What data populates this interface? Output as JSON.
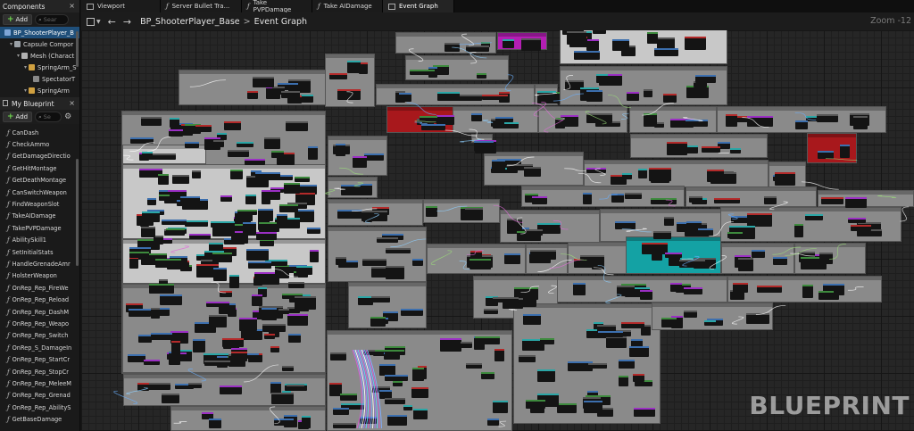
{
  "components_panel": {
    "title": "Components",
    "add_label": "Add",
    "search_placeholder": "Sear",
    "tree": [
      {
        "label": "BP_ShooterPlayer_B",
        "indent": 0,
        "selected": true,
        "icon_color": "#7ea6d8"
      },
      {
        "label": "Capsule Compor",
        "indent": 1,
        "selected": false,
        "icon_color": "#9aa0a6"
      },
      {
        "label": "Mesh (Charact",
        "indent": 2,
        "selected": false,
        "icon_color": "#b0b0b0"
      },
      {
        "label": "SpringArm_S",
        "indent": 3,
        "selected": false,
        "icon_color": "#d0a040"
      },
      {
        "label": "SpectatorT",
        "indent": 4,
        "selected": false,
        "icon_color": "#888"
      },
      {
        "label": "SpringArm",
        "indent": 3,
        "selected": false,
        "icon_color": "#d0a040"
      }
    ]
  },
  "my_blueprint_panel": {
    "title": "My Blueprint",
    "add_label": "Add",
    "search_placeholder": "Se",
    "functions": [
      "CanDash",
      "CheckAmmo",
      "GetDamageDirectio",
      "GetHitMontage",
      "GetDeathMontage",
      "CanSwitchWeapon",
      "FindWeaponSlot",
      "TakeAIDamage",
      "TakePVPDamage",
      "AbilitySkill1",
      "SetInitialStats",
      "HandleGrenadeAmr",
      "HolsterWeapon",
      "OnRep_Rep_FireWe",
      "OnRep_Rep_Reload",
      "OnRep_Rep_DashM",
      "OnRep_Rep_Weapo",
      "OnRep_Rep_Switch",
      "OnRep_S_DamageIn",
      "OnRep_Rep_StartCr",
      "OnRep_Rep_StopCr",
      "OnRep_Rep_MeleeM",
      "OnRep_Rep_Grenad",
      "OnRep_Rep_AbilityS",
      "GetBaseDamage"
    ]
  },
  "tabs": [
    {
      "label": "Viewport",
      "icon": "viewport-icon",
      "active": false
    },
    {
      "label": "Server Bullet Tra...",
      "icon": "function-icon",
      "active": false
    },
    {
      "label": "Take PVPDamage",
      "icon": "function-icon",
      "active": false
    },
    {
      "label": "Take AIDamage",
      "icon": "function-icon",
      "active": false
    },
    {
      "label": "Event Graph",
      "icon": "graph-icon",
      "active": true
    }
  ],
  "breadcrumb": {
    "blueprint": "BP_ShooterPlayer_Base",
    "separator": ">",
    "graph": "Event Graph"
  },
  "zoom_label": "Zoom -12",
  "watermark": "BLUEPRINT",
  "colors": {
    "selection": "#1f4f7a",
    "comment_gray": "#8a8a8a",
    "comment_red": "#a8181c",
    "comment_magenta": "#b41fb4",
    "comment_teal": "#14a2a4",
    "add_plus": "#6fd84f"
  }
}
